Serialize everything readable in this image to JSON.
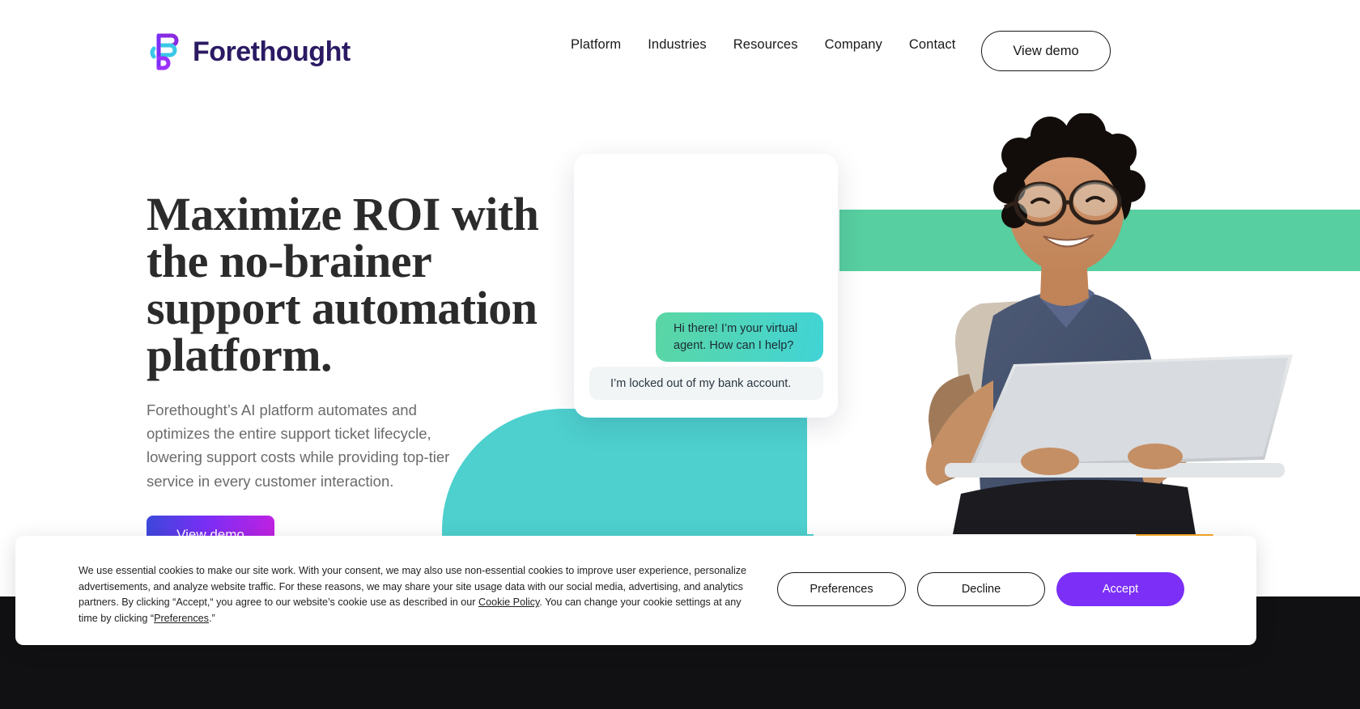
{
  "brand": {
    "name": "Forethought",
    "logo_colors": {
      "purple": "#7b2ff7",
      "cyan": "#3ac7e8",
      "violet": "#8a2be2",
      "wordmark": "#2b1a63"
    }
  },
  "header": {
    "nav_items": [
      {
        "label": "Platform",
        "name": "nav-platform"
      },
      {
        "label": "Industries",
        "name": "nav-industries"
      },
      {
        "label": "Resources",
        "name": "nav-resources"
      },
      {
        "label": "Company",
        "name": "nav-company"
      },
      {
        "label": "Contact",
        "name": "nav-contact"
      }
    ],
    "cta_label": "View demo"
  },
  "hero": {
    "title": "Maximize ROI with the no-brainer support automation platform.",
    "subtitle": "Forethought’s AI platform automates and optimizes the entire support ticket lifecycle, lowering support costs while providing top-tier service in every customer interaction.",
    "cta_label": "View demo"
  },
  "chat": {
    "agent_message": "Hi there! I’m your virtual agent. How can I help?",
    "user_message": "I’m locked out of my bank account."
  },
  "decor": {
    "teal": "#4dd0ce",
    "green_stripe": "#57cfa0",
    "orange_circle": "#f9a826",
    "dashed_arc": "#b9b9c2",
    "footer_bar": "#111113"
  },
  "cookie_banner": {
    "text_part1": "We use essential cookies to make our site work. With your consent, we may also use non-essential cookies to improve user experience, personalize advertisements, and analyze website traffic. For these reasons, we may share your site usage data with our social media, advertising, and analytics partners. By clicking “Accept,“ you agree to our website’s cookie use as described in our ",
    "link_cookie_policy": "Cookie Policy",
    "text_part2": ". You can change your cookie settings at any time by clicking “",
    "link_preferences": "Preferences",
    "text_part3": ".”",
    "buttons": {
      "preferences": "Preferences",
      "decline": "Decline",
      "accept": "Accept"
    },
    "accent_color": "#7b2ff7"
  }
}
